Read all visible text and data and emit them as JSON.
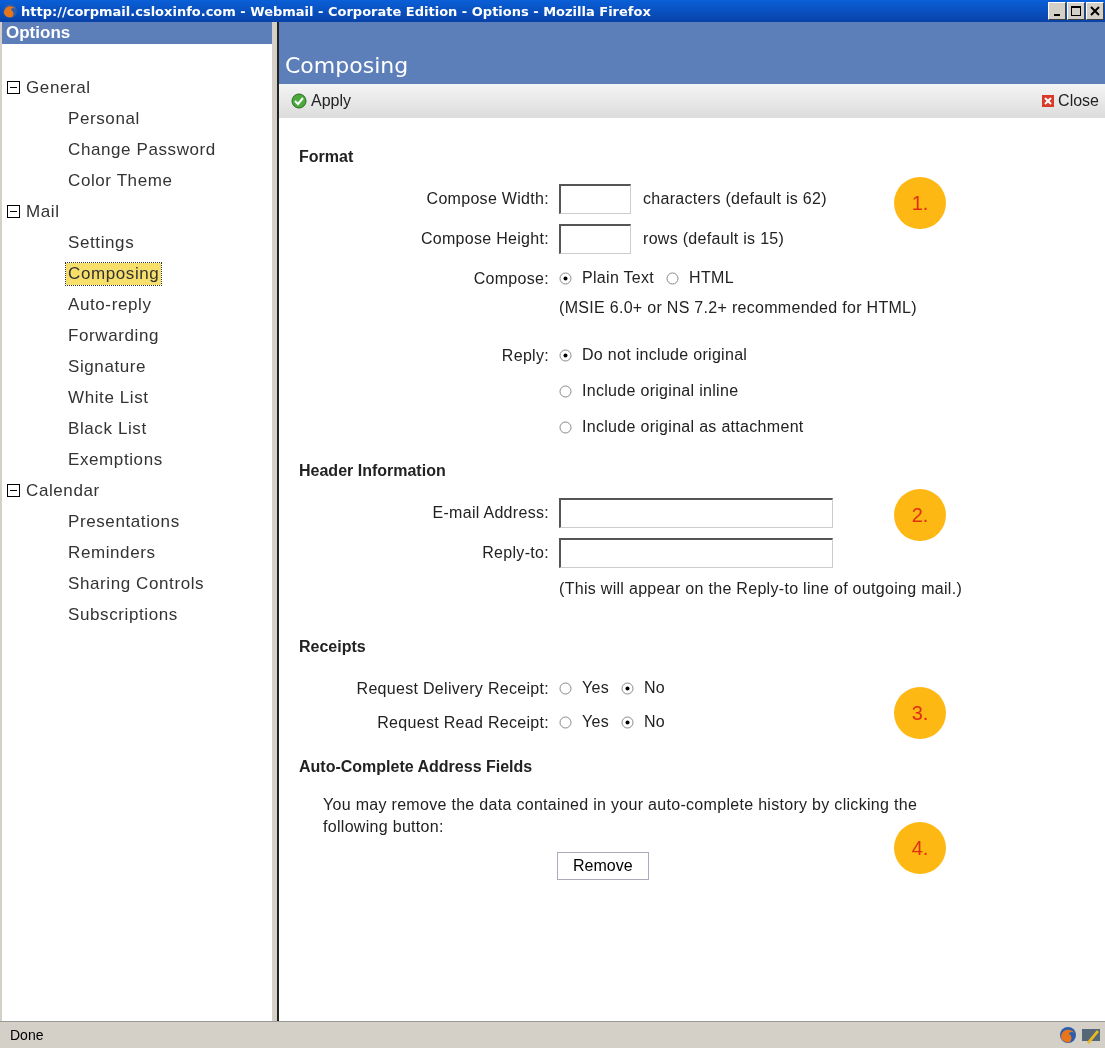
{
  "window": {
    "title": "http://corpmail.csloxinfo.com - Webmail - Corporate Edition - Options - Mozilla Firefox"
  },
  "sidebar": {
    "title": "Options",
    "groups": [
      {
        "label": "General",
        "expanded": true,
        "children": [
          {
            "label": "Personal",
            "selected": false
          },
          {
            "label": "Change Password",
            "selected": false
          },
          {
            "label": "Color Theme",
            "selected": false
          }
        ]
      },
      {
        "label": "Mail",
        "expanded": true,
        "children": [
          {
            "label": "Settings",
            "selected": false
          },
          {
            "label": "Composing",
            "selected": true
          },
          {
            "label": "Auto-reply",
            "selected": false
          },
          {
            "label": "Forwarding",
            "selected": false
          },
          {
            "label": "Signature",
            "selected": false
          },
          {
            "label": "White List",
            "selected": false
          },
          {
            "label": "Black List",
            "selected": false
          },
          {
            "label": "Exemptions",
            "selected": false
          }
        ]
      },
      {
        "label": "Calendar",
        "expanded": true,
        "children": [
          {
            "label": "Presentations",
            "selected": false
          },
          {
            "label": "Reminders",
            "selected": false
          },
          {
            "label": "Sharing Controls",
            "selected": false
          },
          {
            "label": "Subscriptions",
            "selected": false
          }
        ]
      }
    ]
  },
  "page": {
    "title": "Composing",
    "apply": "Apply",
    "close": "Close"
  },
  "sections": [
    {
      "title": "Format",
      "annotation": "1.",
      "rows": [
        {
          "kind": "short_field",
          "label": "Compose Width:",
          "suffix": "characters (default is 62)"
        },
        {
          "kind": "short_field",
          "label": "Compose Height:",
          "suffix": "rows (default is 15)"
        },
        {
          "kind": "inline_radios",
          "label": "Compose:",
          "options": [
            {
              "label": "Plain Text",
              "selected": true
            },
            {
              "label": "HTML",
              "selected": false
            }
          ],
          "note": "(MSIE 6.0+ or NS 7.2+ recommended for HTML)"
        },
        {
          "kind": "stacked_radios",
          "label": "Reply:",
          "options": [
            {
              "label": "Do not include original",
              "selected": true
            },
            {
              "label": "Include original inline",
              "selected": false
            },
            {
              "label": "Include original as attachment",
              "selected": false
            }
          ]
        }
      ]
    },
    {
      "title": "Header Information",
      "annotation": "2.",
      "rows": [
        {
          "kind": "long_field",
          "label": "E-mail Address:"
        },
        {
          "kind": "long_field",
          "label": "Reply-to:",
          "note": "(This will appear on the Reply-to line of outgoing mail.)"
        }
      ]
    },
    {
      "title": "Receipts",
      "annotation": "3.",
      "rows": [
        {
          "kind": "inline_radios",
          "label": "Request Delivery Receipt:",
          "options": [
            {
              "label": "Yes",
              "selected": false
            },
            {
              "label": "No",
              "selected": true
            }
          ]
        },
        {
          "kind": "inline_radios",
          "label": "Request Read Receipt:",
          "options": [
            {
              "label": "Yes",
              "selected": false
            },
            {
              "label": "No",
              "selected": true
            }
          ]
        }
      ]
    },
    {
      "title": "Auto-Complete Address Fields",
      "annotation": "4.",
      "rows": [
        {
          "kind": "text",
          "text": "You may remove the data contained in your auto-complete history by clicking the following button:"
        },
        {
          "kind": "button",
          "label": "Remove"
        }
      ]
    }
  ],
  "status_bar": {
    "text": "Done"
  }
}
